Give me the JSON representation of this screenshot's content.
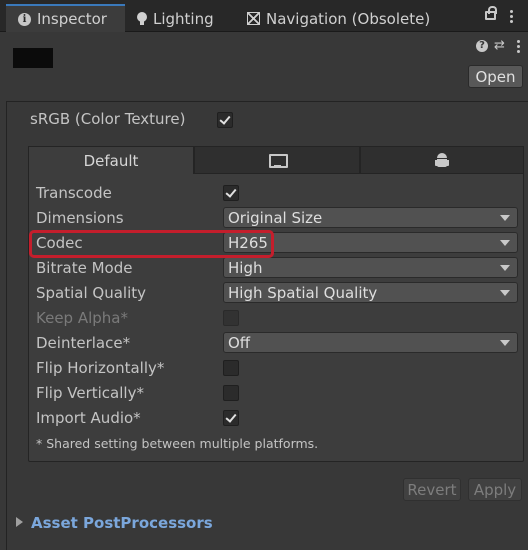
{
  "tabs": [
    {
      "label": "Inspector",
      "icon": "info-icon"
    },
    {
      "label": "Lighting",
      "icon": "bulb-icon"
    },
    {
      "label": "Navigation (Obsolete)",
      "icon": "navigation-icon"
    }
  ],
  "header": {
    "open_label": "Open",
    "help_glyph": "?",
    "presets_glyph": "⇄"
  },
  "srgb": {
    "label": "sRGB (Color Texture)",
    "checked": true
  },
  "platform_tabs": [
    {
      "label": "Default",
      "active": true
    },
    {
      "label": "",
      "icon": "monitor-icon"
    },
    {
      "label": "",
      "icon": "android-icon"
    }
  ],
  "settings": [
    {
      "label": "Transcode",
      "type": "checkbox",
      "checked": true
    },
    {
      "label": "Dimensions",
      "type": "dropdown",
      "value": "Original Size"
    },
    {
      "label": "Codec",
      "type": "dropdown",
      "value": "H265"
    },
    {
      "label": "Bitrate Mode",
      "type": "dropdown",
      "value": "High"
    },
    {
      "label": "Spatial Quality",
      "type": "dropdown",
      "value": "High Spatial Quality"
    },
    {
      "label": "Keep Alpha*",
      "type": "checkbox",
      "checked": false,
      "disabled": true
    },
    {
      "label": "Deinterlace*",
      "type": "dropdown",
      "value": "Off"
    },
    {
      "label": "Flip Horizontally*",
      "type": "checkbox",
      "checked": false
    },
    {
      "label": "Flip Vertically*",
      "type": "checkbox",
      "checked": false
    },
    {
      "label": "Import Audio*",
      "type": "checkbox",
      "checked": true
    }
  ],
  "note": "* Shared setting between multiple platforms.",
  "buttons": {
    "revert": "Revert",
    "apply": "Apply"
  },
  "foldout": {
    "label": "Asset PostProcessors"
  },
  "colors": {
    "accent": "#3a79bb",
    "highlight": "#c41e2c",
    "link": "#7ba7dc"
  }
}
